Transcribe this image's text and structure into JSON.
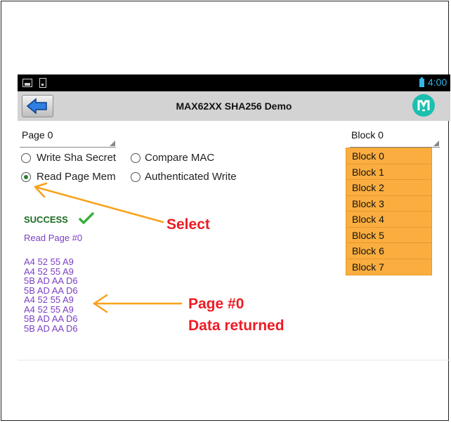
{
  "status_bar": {
    "time": "4:00"
  },
  "action_bar": {
    "title": "MAX62XX SHA256 Demo"
  },
  "page_spinner": {
    "value": "Page 0"
  },
  "block_spinner": {
    "value": "Block 0"
  },
  "radios": [
    {
      "label": "Write Sha Secret",
      "checked": false
    },
    {
      "label": "Compare MAC",
      "checked": false
    },
    {
      "label": "Read Page Mem",
      "checked": true
    },
    {
      "label": "Authenticated Write",
      "checked": false
    }
  ],
  "block_list": [
    "Block 0",
    "Block 1",
    "Block 2",
    "Block 3",
    "Block 4",
    "Block 5",
    "Block 6",
    "Block 7"
  ],
  "result": {
    "status": "SUCCESS",
    "operation": "Read Page #0",
    "data_lines": [
      "A4 52 55 A9",
      "A4 52 55 A9",
      "5B AD AA D6",
      "5B AD AA D6",
      "A4 52 55 A9",
      "A4 52 55 A9",
      "5B AD AA D6",
      "5B AD AA D6"
    ]
  },
  "annotations": {
    "select": "Select",
    "page_line1": "Page #0",
    "page_line2": "Data returned",
    "color": "#ee1c24",
    "arrow_color": "#f7a21b"
  },
  "colors": {
    "status_bar_bg": "#000000",
    "status_accent": "#33b5e5",
    "action_bar_bg": "#d3d3d3",
    "list_bg": "#fbae3f",
    "success_green": "#1b6b22",
    "data_purple": "#7b3fc4"
  },
  "icons": {
    "back": "arrow-left-icon",
    "logo": "maxim-logo-icon",
    "battery": "battery-icon",
    "checkmark": "checkmark-icon"
  }
}
